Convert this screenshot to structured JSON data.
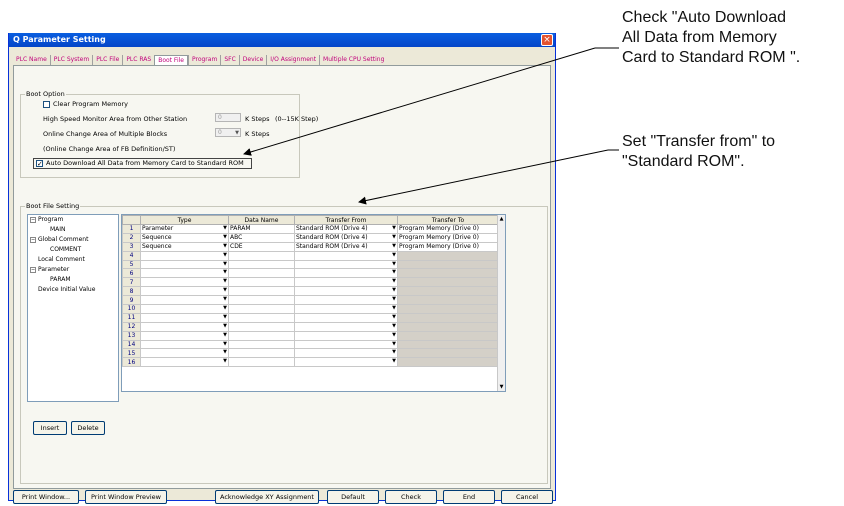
{
  "window": {
    "title": "Q Parameter Setting",
    "close_label": "×"
  },
  "tabs": [
    {
      "label": "PLC Name"
    },
    {
      "label": "PLC System"
    },
    {
      "label": "PLC File"
    },
    {
      "label": "PLC RAS"
    },
    {
      "label": "Boot File"
    },
    {
      "label": "Program"
    },
    {
      "label": "SFC"
    },
    {
      "label": "Device"
    },
    {
      "label": "I/O Assignment"
    },
    {
      "label": "Multiple CPU Setting"
    }
  ],
  "boot_option": {
    "title": "Boot Option",
    "clear_program_memory": "Clear Program Memory",
    "high_speed_label": "High Speed Monitor Area from Other Station",
    "high_speed_value": "0",
    "high_speed_unit": "K Steps",
    "high_speed_range": "(0--15K Step)",
    "online_change_label": "Online Change Area of Multiple Blocks",
    "online_change_value": "0",
    "online_change_unit": "K Steps",
    "online_change_fb": "(Online Change Area of FB Definition/ST)",
    "auto_download_label": "Auto Download All Data from Memory Card to Standard ROM",
    "auto_download_checked": "✓"
  },
  "boot_file": {
    "title": "Boot File Setting",
    "tree": [
      {
        "label": "Program",
        "expander": "−"
      },
      {
        "label": "MAIN"
      },
      {
        "label": "Global Comment",
        "expander": "−"
      },
      {
        "label": "COMMENT"
      },
      {
        "label": "Local Comment"
      },
      {
        "label": "Parameter",
        "expander": "−"
      },
      {
        "label": "PARAM"
      },
      {
        "label": "Device Initial Value"
      }
    ],
    "columns": [
      "Type",
      "Data Name",
      "Transfer From",
      "Transfer To"
    ],
    "rows": [
      {
        "no": "1",
        "type": "Parameter",
        "name": "PARAM",
        "from": "Standard ROM (Drive 4)",
        "to": "Program Memory (Drive 0)"
      },
      {
        "no": "2",
        "type": "Sequence",
        "name": "ABC",
        "from": "Standard ROM (Drive 4)",
        "to": "Program Memory (Drive 0)"
      },
      {
        "no": "3",
        "type": "Sequence",
        "name": "CDE",
        "from": "Standard ROM (Drive 4)",
        "to": "Program Memory (Drive 0)"
      },
      {
        "no": "4",
        "type": "",
        "name": "",
        "from": "",
        "to": ""
      },
      {
        "no": "5",
        "type": "",
        "name": "",
        "from": "",
        "to": ""
      },
      {
        "no": "6",
        "type": "",
        "name": "",
        "from": "",
        "to": ""
      },
      {
        "no": "7",
        "type": "",
        "name": "",
        "from": "",
        "to": ""
      },
      {
        "no": "8",
        "type": "",
        "name": "",
        "from": "",
        "to": ""
      },
      {
        "no": "9",
        "type": "",
        "name": "",
        "from": "",
        "to": ""
      },
      {
        "no": "10",
        "type": "",
        "name": "",
        "from": "",
        "to": ""
      },
      {
        "no": "11",
        "type": "",
        "name": "",
        "from": "",
        "to": ""
      },
      {
        "no": "12",
        "type": "",
        "name": "",
        "from": "",
        "to": ""
      },
      {
        "no": "13",
        "type": "",
        "name": "",
        "from": "",
        "to": ""
      },
      {
        "no": "14",
        "type": "",
        "name": "",
        "from": "",
        "to": ""
      },
      {
        "no": "15",
        "type": "",
        "name": "",
        "from": "",
        "to": ""
      },
      {
        "no": "16",
        "type": "",
        "name": "",
        "from": "",
        "to": ""
      }
    ],
    "insert_button": "Insert",
    "delete_button": "Delete"
  },
  "footer": {
    "print_window": "Print Window...",
    "print_preview": "Print Window Preview",
    "acknowledge": "Acknowledge XY Assignment",
    "default": "Default",
    "check": "Check",
    "end": "End",
    "cancel": "Cancel"
  },
  "callouts": {
    "callout1": [
      "Check \"Auto Download",
      "All Data from Memory",
      "Card to Standard ROM \"."
    ],
    "callout2": [
      "Set \"Transfer from\" to",
      "\"Standard ROM\"."
    ]
  }
}
